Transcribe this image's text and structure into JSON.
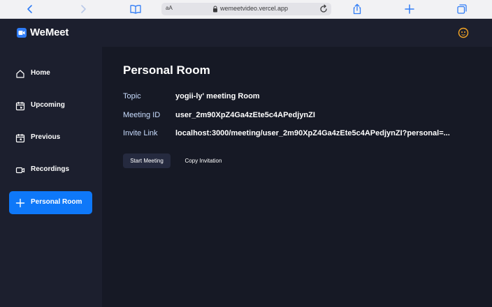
{
  "browser": {
    "aa_label": "aA",
    "url": "wemeetvideo.vercel.app"
  },
  "app": {
    "name": "WeMeet"
  },
  "sidebar": {
    "items": [
      {
        "label": "Home",
        "icon": "home-icon",
        "active": false
      },
      {
        "label": "Upcoming",
        "icon": "calendar-upcoming-icon",
        "active": false
      },
      {
        "label": "Previous",
        "icon": "calendar-previous-icon",
        "active": false
      },
      {
        "label": "Recordings",
        "icon": "video-icon",
        "active": false
      },
      {
        "label": "Personal Room",
        "icon": "plus-icon",
        "active": true
      }
    ]
  },
  "main": {
    "title": "Personal Room",
    "rows": [
      {
        "label": "Topic",
        "value": "yogii-ly' meeting Room"
      },
      {
        "label": "Meeting ID",
        "value": "user_2m90XpZ4Ga4zEte5c4APedjynZI"
      },
      {
        "label": "Invite Link",
        "value": "localhost:3000/meeting/user_2m90XpZ4Ga4zEte5c4APedjynZI?personal=..."
      }
    ],
    "start_button": "Start Meeting",
    "copy_button": "Copy Invitation"
  },
  "colors": {
    "accent": "#0E78F9",
    "background": "#1C1F2E",
    "main_background": "#161925",
    "label": "#C9DDFF"
  }
}
